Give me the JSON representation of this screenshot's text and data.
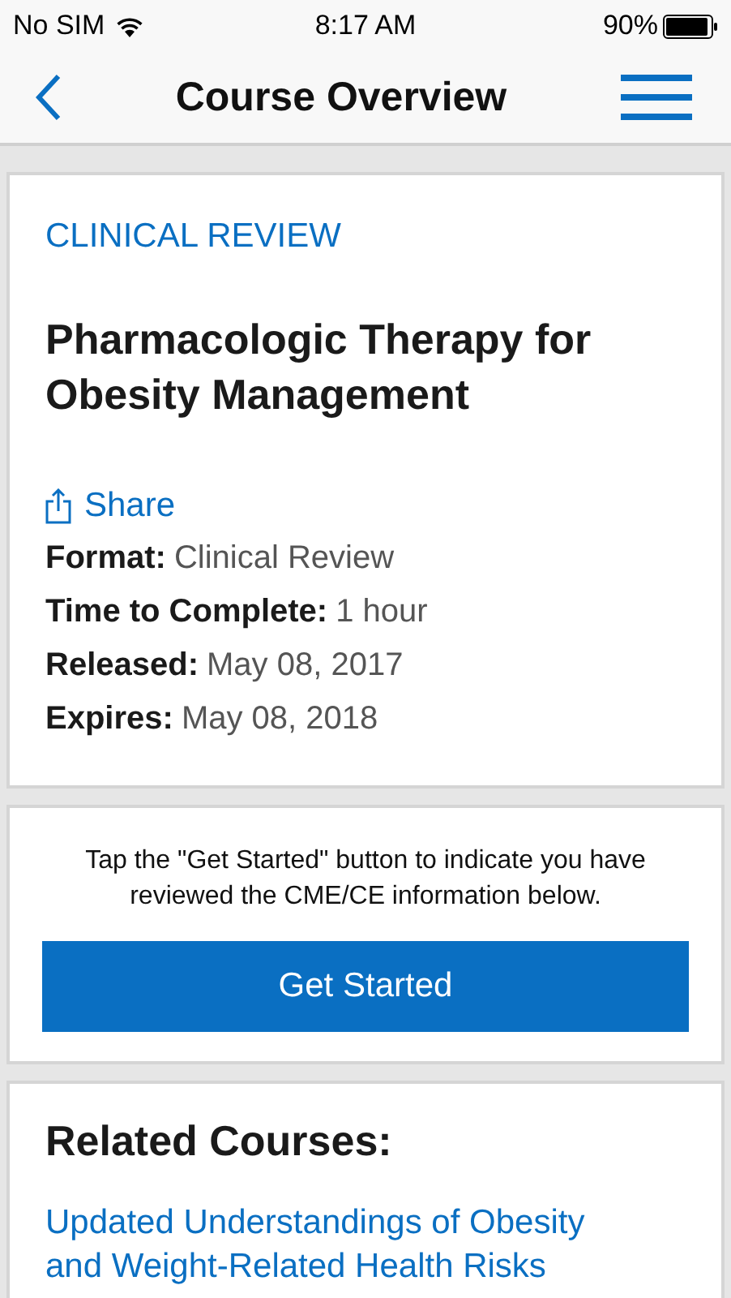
{
  "status_bar": {
    "carrier": "No SIM",
    "time": "8:17 AM",
    "battery": "90%"
  },
  "nav_bar": {
    "title": "Course Overview"
  },
  "course": {
    "category": "CLINICAL REVIEW",
    "title": "Pharmacologic Therapy for Obesity Management",
    "share": "Share",
    "details": [
      {
        "label": "Format:",
        "value": "Clinical Review"
      },
      {
        "label": "Time to Complete:",
        "value": "1 hour"
      },
      {
        "label": "Released:",
        "value": "May 08, 2017"
      },
      {
        "label": "Expires:",
        "value": "May 08, 2018"
      }
    ]
  },
  "start": {
    "instruction": "Tap the \"Get Started\" button to indicate you have reviewed the CME/CE information below.",
    "button": "Get Started"
  },
  "related": {
    "heading": "Related Courses:",
    "links": [
      "Updated Understandings of Obesity and Weight-Related Health Risks"
    ]
  }
}
